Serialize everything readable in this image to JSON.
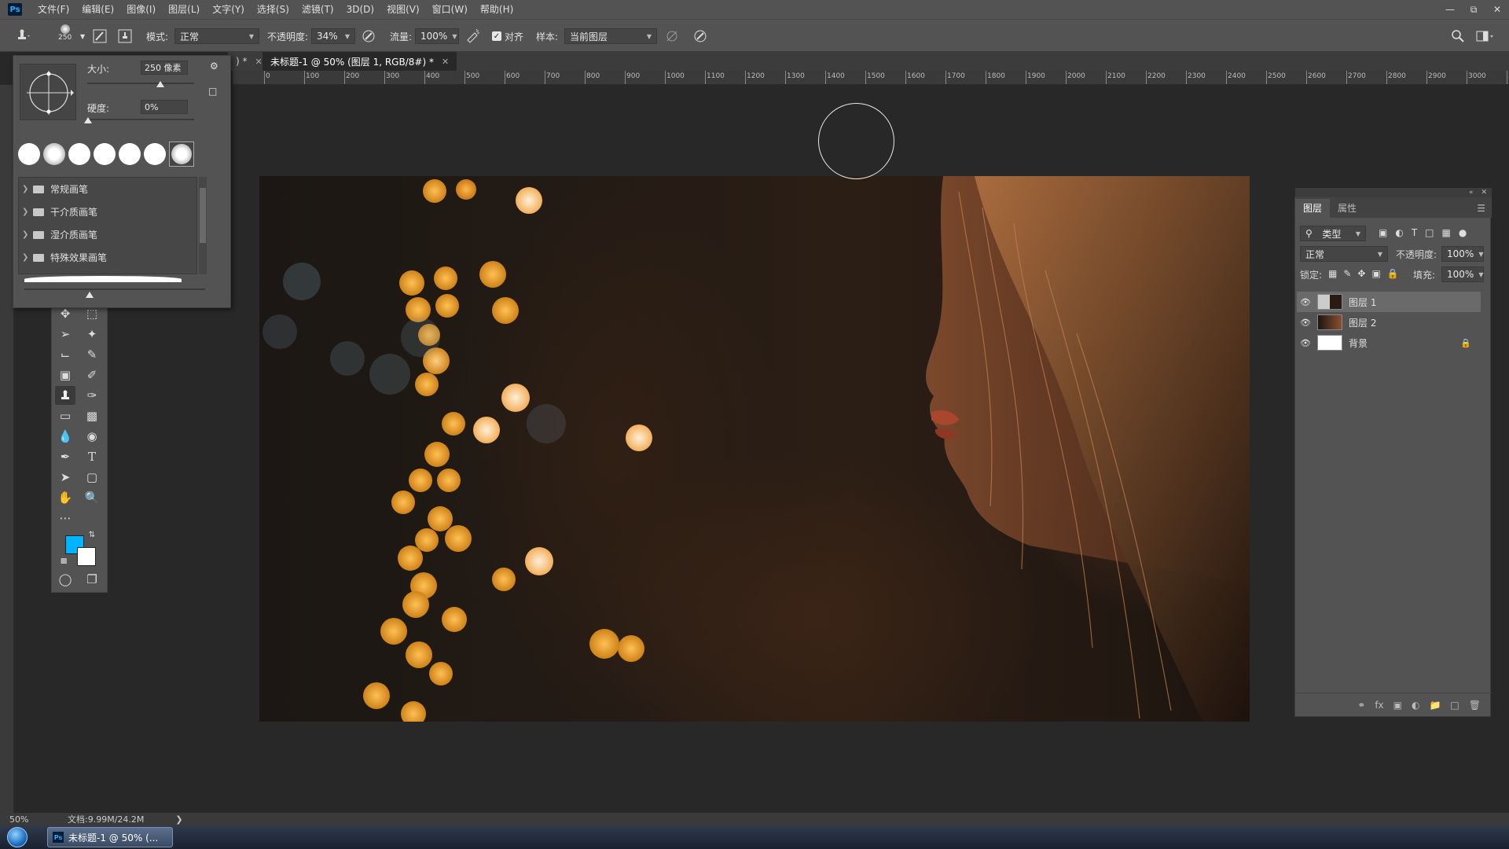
{
  "app": {
    "logo": "Ps"
  },
  "menu": [
    "文件(F)",
    "编辑(E)",
    "图像(I)",
    "图层(L)",
    "文字(Y)",
    "选择(S)",
    "滤镜(T)",
    "3D(D)",
    "视图(V)",
    "窗口(W)",
    "帮助(H)"
  ],
  "options": {
    "brush_size_label": "250",
    "mode_label": "模式:",
    "mode_value": "正常",
    "opacity_label": "不透明度:",
    "opacity_value": "34%",
    "flow_label": "流量:",
    "flow_value": "100%",
    "aligned_label": "对齐",
    "sample_label": "样本:",
    "sample_value": "当前图层"
  },
  "tabs": {
    "prev_tab": ") *",
    "active_tab": "未标题-1 @ 50% (图层 1, RGB/8#) *"
  },
  "ruler_h_labels": [
    "0",
    "100",
    "200",
    "300",
    "400",
    "500",
    "600",
    "700",
    "800",
    "900",
    "1000",
    "1100",
    "1200",
    "1300",
    "1400",
    "1500",
    "1600",
    "1700",
    "1800",
    "1900",
    "2000",
    "2100",
    "2200",
    "2300",
    "2400",
    "2500",
    "2600",
    "2700",
    "2800",
    "2900",
    "3000",
    "310"
  ],
  "brush_popup": {
    "size_label": "大小:",
    "size_value": "250 像素",
    "hardness_label": "硬度:",
    "hardness_value": "0%",
    "groups": [
      "常规画笔",
      "干介质画笔",
      "湿介质画笔",
      "特殊效果画笔"
    ]
  },
  "colors": {
    "foreground": "#00b4ff",
    "background": "#ffffff"
  },
  "layers_panel": {
    "tabs": [
      "图层",
      "属性"
    ],
    "filter_label": "类型",
    "blend_mode": "正常",
    "opacity_label": "不透明度:",
    "opacity_value": "100%",
    "lock_label": "锁定:",
    "fill_label": "填充:",
    "fill_value": "100%",
    "layers": [
      {
        "name": "图层 1",
        "active": true
      },
      {
        "name": "图层 2",
        "active": false
      },
      {
        "name": "背景",
        "active": false,
        "locked": true
      }
    ]
  },
  "status": {
    "zoom": "50%",
    "doc_size": "文档:9.99M/24.2M"
  },
  "taskbar": {
    "item_label": "未标题-1 @ 50% (..."
  }
}
